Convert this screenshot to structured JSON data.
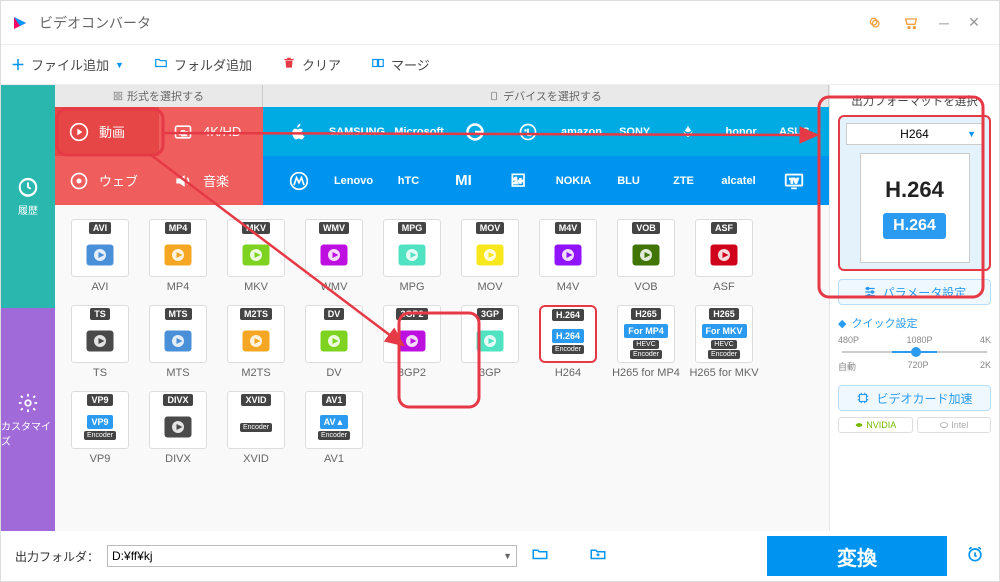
{
  "app": {
    "title": "ビデオコンバータ"
  },
  "toolbar": {
    "add_file": "ファイル追加",
    "add_folder": "フォルダ追加",
    "clear": "クリア",
    "merge": "マージ"
  },
  "rail": {
    "history": "履歴",
    "customize": "カスタマイズ"
  },
  "tabs": {
    "format": "形式を選択する",
    "device": "デバイスを選択する"
  },
  "format_buttons": {
    "video": "動画",
    "fourk": "4K/HD",
    "web": "ウェブ",
    "music": "音楽"
  },
  "brands_row1": [
    "Apple",
    "SAMSUNG",
    "Microsoft",
    "G",
    "LG",
    "amazon",
    "SONY",
    "HUAWEI",
    "honor",
    "ASUS"
  ],
  "brands_row2": [
    "Motorola",
    "Lenovo",
    "hTC",
    "MI",
    "OnePlus",
    "NOKIA",
    "BLU",
    "ZTE",
    "alcatel",
    "TV"
  ],
  "formats": [
    {
      "badge": "AVI",
      "label": "AVI"
    },
    {
      "badge": "MP4",
      "label": "MP4"
    },
    {
      "badge": "MKV",
      "label": "MKV"
    },
    {
      "badge": "WMV",
      "label": "WMV"
    },
    {
      "badge": "MPG",
      "label": "MPG"
    },
    {
      "badge": "MOV",
      "label": "MOV"
    },
    {
      "badge": "M4V",
      "label": "M4V"
    },
    {
      "badge": "VOB",
      "label": "VOB"
    },
    {
      "badge": "ASF",
      "label": "ASF"
    },
    {
      "badge": "TS",
      "label": "TS"
    },
    {
      "badge": "MTS",
      "label": "MTS"
    },
    {
      "badge": "M2TS",
      "label": "M2TS"
    },
    {
      "badge": "DV",
      "label": "DV"
    },
    {
      "badge": "3GP2",
      "label": "3GP2"
    },
    {
      "badge": "3GP",
      "label": "3GP"
    },
    {
      "badge": "H.264",
      "sub": "H.264",
      "enc": "Encoder",
      "label": "H264",
      "selected": true
    },
    {
      "badge": "H265",
      "sub": "For MP4",
      "enc": "HEVC",
      "enc2": "Encoder",
      "label": "H265 for MP4"
    },
    {
      "badge": "H265",
      "sub": "For MKV",
      "enc": "HEVC",
      "enc2": "Encoder",
      "label": "H265 for MKV"
    },
    {
      "badge": "VP9",
      "sub": "VP9",
      "enc": "Encoder",
      "label": "VP9"
    },
    {
      "badge": "DIVX",
      "label": "DIVX"
    },
    {
      "badge": "XVID",
      "enc": "Encoder",
      "label": "XVID"
    },
    {
      "badge": "AV1",
      "sub": "AV▲",
      "enc": "Encoder",
      "label": "AV1"
    }
  ],
  "right": {
    "title": "出力フォーマットを選択",
    "selected": "H264",
    "preview_top": "H.264",
    "preview_chip": "H.264",
    "param_btn": "パラメータ設定",
    "quick_label": "クイック設定",
    "quality_top": [
      "480P",
      "1080P",
      "4K"
    ],
    "quality_bottom": [
      "自動",
      "720P",
      "2K"
    ],
    "gpu_btn": "ビデオカード加速",
    "gpu_nvidia": "NVIDIA",
    "gpu_intel": "Intel"
  },
  "footer": {
    "label": "出力フォルダ：",
    "path": "D:¥ff¥kj",
    "convert": "変換"
  }
}
